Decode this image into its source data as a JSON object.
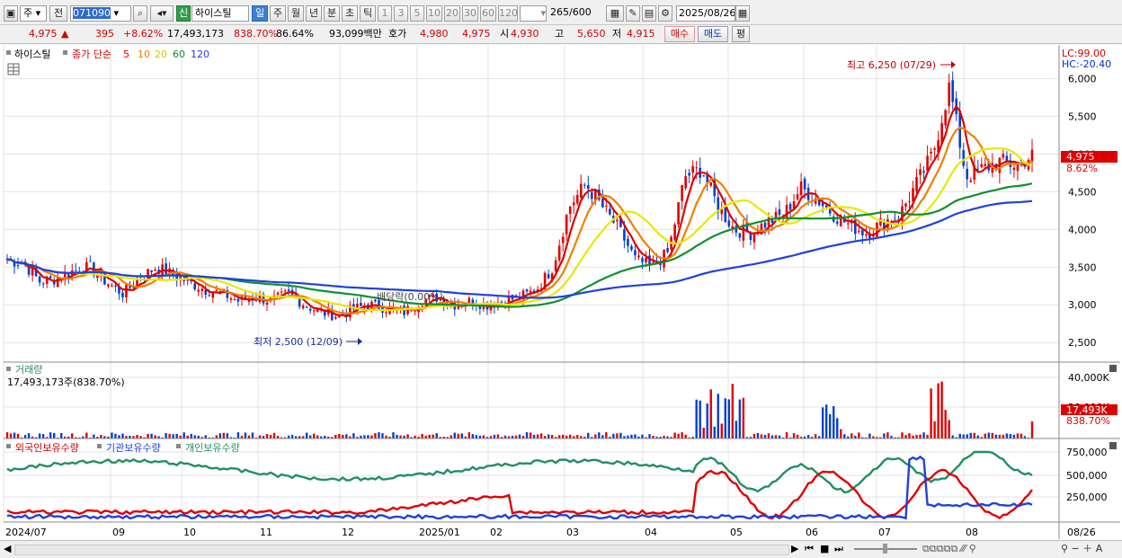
{
  "toolbar": {
    "period_type": "주",
    "prev_label": "전",
    "stock_code": "071090",
    "new_badge": "신",
    "stock_name": "하이스틸",
    "periods": [
      "일",
      "주",
      "월",
      "년",
      "분",
      "초",
      "틱"
    ],
    "intervals": [
      "1",
      "3",
      "5",
      "10",
      "20",
      "30",
      "60",
      "120"
    ],
    "count": "265",
    "count_total": "/600",
    "date": "2025/08/26"
  },
  "quote": {
    "price": "4,975",
    "change": "395",
    "change_pct": "+8.62%",
    "volume": "17,493,173",
    "volume_pct": "838.70%",
    "ratio": "86.64%",
    "amount": "93,099백만",
    "bid_label": "호가",
    "bid1": "4,980",
    "bid2": "4,975",
    "open_label": "시",
    "open": "4,930",
    "high_label": "고",
    "high": "5,650",
    "low_label": "저",
    "low": "4,915",
    "buy_label": "매수",
    "sell_label": "매도",
    "eval_label": "평"
  },
  "legend": {
    "stock_name": "하이스틸",
    "ma_label": "종가 단순",
    "ma_periods": [
      "5",
      "10",
      "20",
      "60",
      "120"
    ]
  },
  "price_panel": {
    "lc_label": "LC:99.00",
    "hc_label": "HC:-20.40",
    "high_note": "최고 6,250 (07/29)",
    "low_note": "최저 2,500 (12/09)",
    "dividend_note": "배당락(0.00%)",
    "current_price_tag": "4,975",
    "current_pct_tag": "8.62%",
    "y_ticks": [
      "6,000",
      "5,500",
      "5,000",
      "4,500",
      "4,000",
      "3,500",
      "3,000",
      "2,500"
    ]
  },
  "volume_panel": {
    "title": "거래량",
    "value": "17,493,173주(838.70%)",
    "y_ticks": [
      "40,000K",
      "20,000K"
    ],
    "tag_value": "17,493K",
    "tag_pct": "838.70%"
  },
  "holdings_panel": {
    "titles": [
      "외국인보유수량",
      "기관보유수량",
      "개인보유수량"
    ],
    "y_ticks": [
      "750,000",
      "500,000",
      "250,000"
    ]
  },
  "x_axis": {
    "labels": [
      "2024/07",
      "09",
      "10",
      "11",
      "12",
      "2025/01",
      "02",
      "03",
      "04",
      "05",
      "06",
      "07",
      "08",
      "08/26"
    ]
  },
  "colors": {
    "up": "#e00000",
    "down": "#0040d0",
    "ma5": "#e00000",
    "ma10": "#f08000",
    "ma20": "#e8e800",
    "ma60": "#109030",
    "ma120": "#2040e0",
    "foreign": "#e00000",
    "institution": "#2040e0",
    "individual": "#209060"
  },
  "chart_data": {
    "type": "candlestick",
    "ohlc_weekly_close_approx": [
      3600,
      3550,
      3300,
      3350,
      3450,
      3500,
      3300,
      3150,
      3350,
      3500,
      3400,
      3300,
      3200,
      3150,
      3050,
      3100,
      3050,
      3150,
      3000,
      2900,
      2850,
      2950,
      3000,
      2950,
      2900,
      3050,
      3100,
      3000,
      3050,
      3000,
      3050,
      3100,
      3200,
      3500,
      4300,
      4600,
      4300,
      4000,
      3600,
      3500,
      3700,
      4700,
      4800,
      4300,
      4000,
      3950,
      4100,
      4200,
      4550,
      4400,
      4200,
      4050,
      3950,
      4100,
      4200,
      4600,
      5000,
      5900,
      4700,
      4800,
      4900,
      4850,
      4975
    ],
    "ma": {
      "periods": [
        5,
        10,
        20,
        60,
        120
      ]
    },
    "ylim": [
      2300,
      6350
    ],
    "y_ticks": [
      2500,
      3000,
      3500,
      4000,
      4500,
      5000,
      5500,
      6000
    ],
    "annotations": [
      {
        "label": "최고 6,250 (07/29)",
        "value": 6250
      },
      {
        "label": "최저 2,500 (12/09)",
        "value": 2500
      }
    ]
  }
}
